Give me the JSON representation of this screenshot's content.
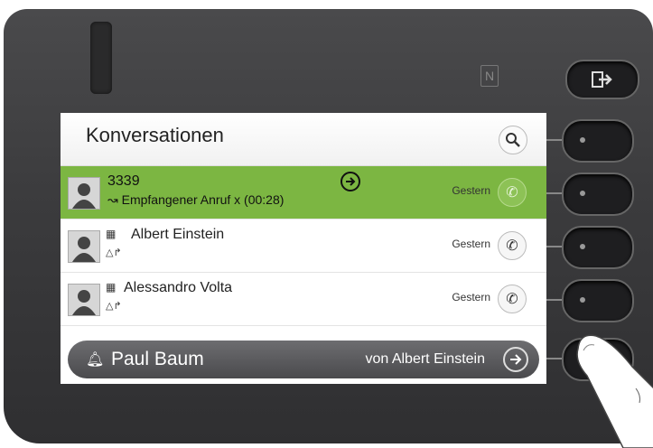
{
  "screen": {
    "title": "Konversationen",
    "rows": [
      {
        "name": "3339",
        "detail": "Empfangener Anruf x (00:28)",
        "date": "Gestern",
        "active": true
      },
      {
        "name": "Albert Einstein",
        "detail": "",
        "date": "Gestern",
        "active": false
      },
      {
        "name": "Alessandro Volta",
        "detail": "",
        "date": "Gestern",
        "active": false
      }
    ],
    "notification": {
      "name": "Paul Baum",
      "from": "von Albert Einstein"
    }
  },
  "icons": {
    "search": "search-icon",
    "call": "phone-icon",
    "forward": "arrow-right-icon",
    "exit": "exit-icon",
    "nfc": "nfc-icon",
    "bell": "bell-icon"
  },
  "colors": {
    "accent": "#7cb642",
    "bezel": "#3b3b3d",
    "notification_bar": "#5a5a5d"
  }
}
